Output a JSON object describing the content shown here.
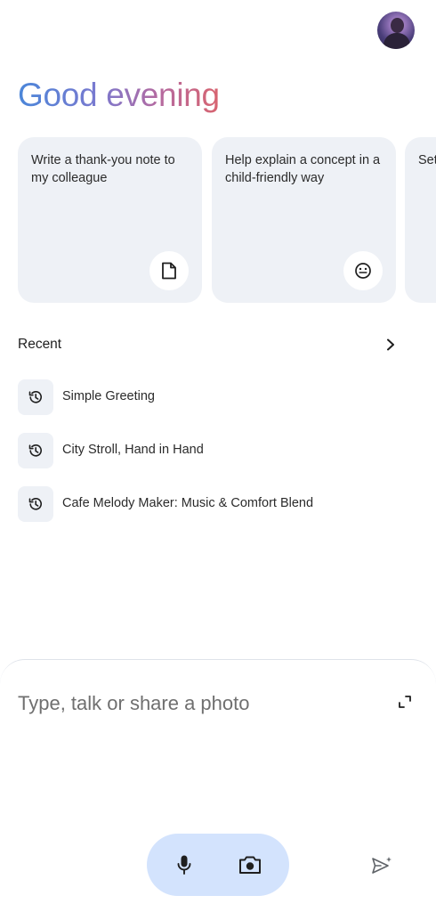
{
  "header": {
    "avatar_icon": "user-avatar-icon"
  },
  "greeting": "Good evening",
  "greeting_gradient": [
    "#4b86d9",
    "#7a79cf",
    "#b56aa0",
    "#d8646f"
  ],
  "suggestion_cards": [
    {
      "text": "Write a thank-you note to my colleague",
      "icon": "document-icon"
    },
    {
      "text": "Help explain a concept in a child-friendly way",
      "icon": "smiley-face-icon"
    },
    {
      "text": "Set your",
      "icon": ""
    }
  ],
  "recent": {
    "title": "Recent",
    "chevron_icon": "chevron-right-icon",
    "items": [
      {
        "label": "Simple Greeting",
        "icon": "history-icon"
      },
      {
        "label": "City Stroll, Hand in Hand",
        "icon": "history-icon"
      },
      {
        "label": "Cafe Melody Maker: Music & Comfort Blend",
        "icon": "history-icon"
      }
    ]
  },
  "composer": {
    "placeholder": "Type, talk or share a photo",
    "value": "",
    "expand_icon": "expand-icon",
    "mic_icon": "microphone-icon",
    "camera_icon": "camera-icon",
    "send_icon": "send-sparkle-icon"
  },
  "colors": {
    "card_bg": "#eef1f6",
    "pill_bg": "#d3e3fd",
    "text": "#1f1f1f"
  }
}
